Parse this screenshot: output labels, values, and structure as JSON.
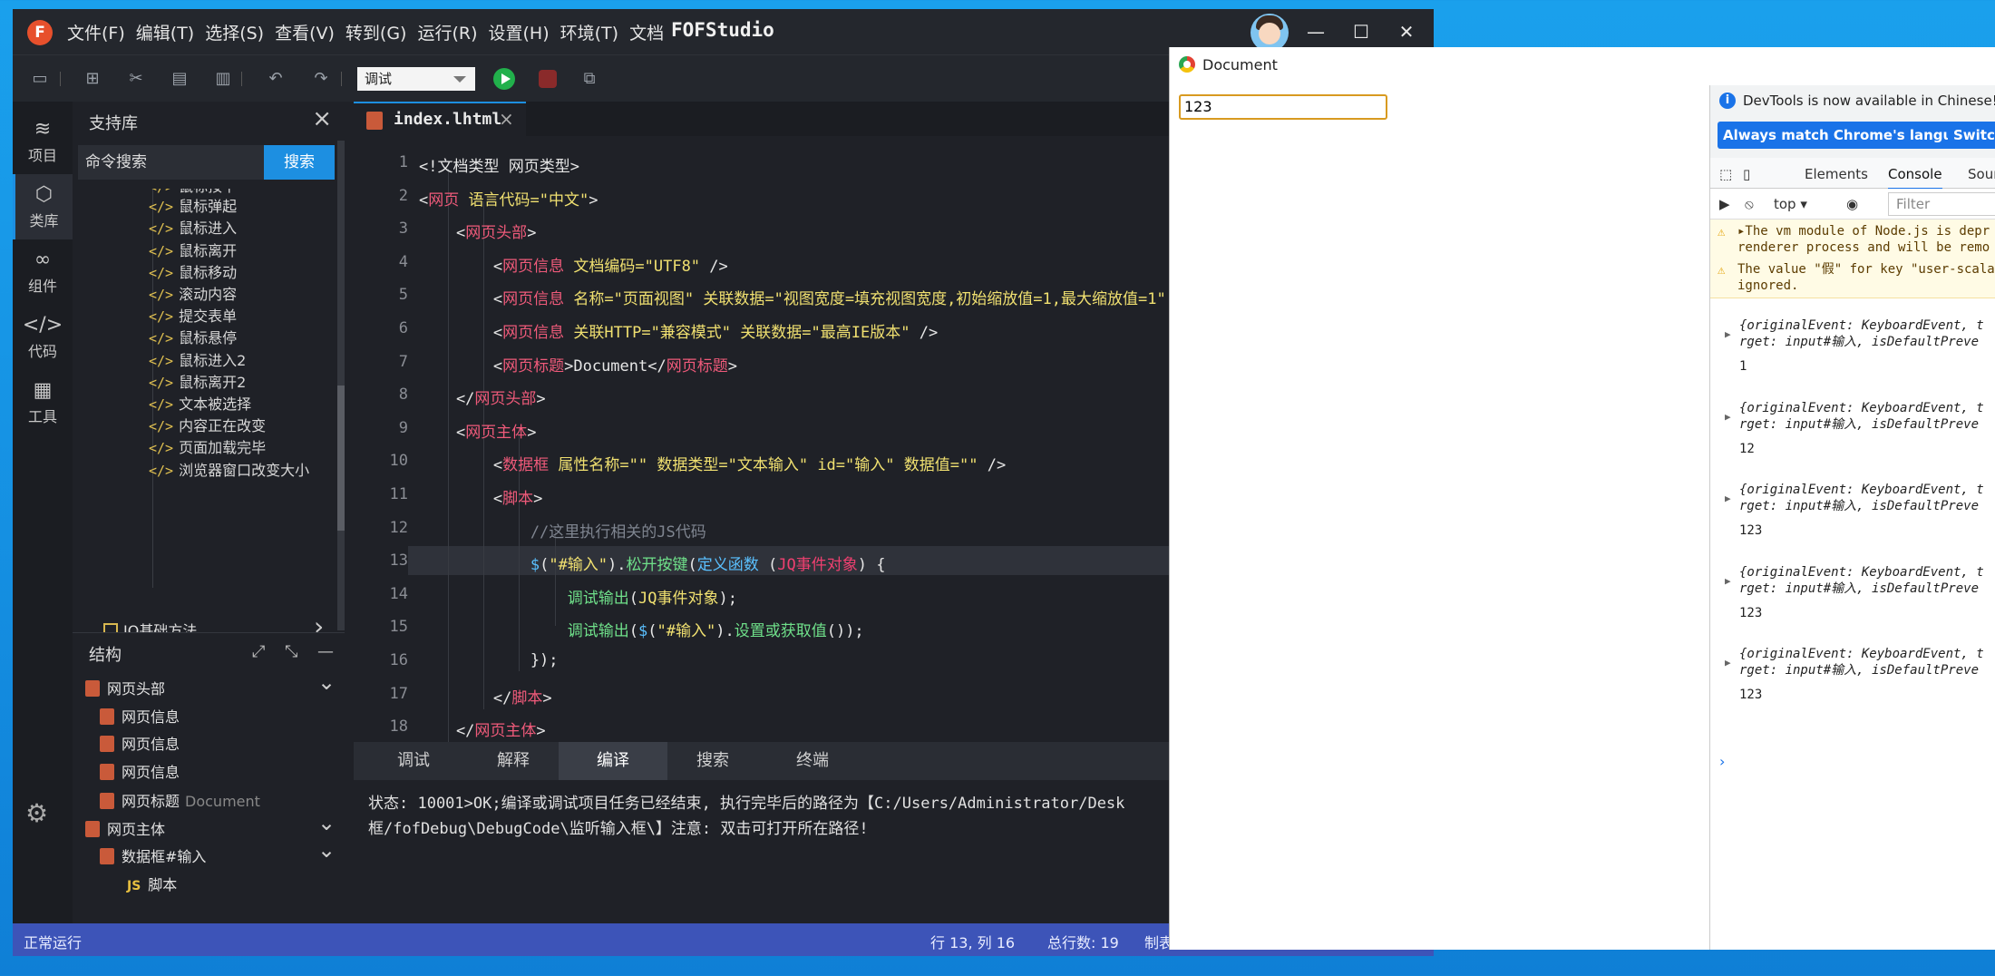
{
  "ide": {
    "logo": "F",
    "menu": [
      "文件(F)",
      "编辑(T)",
      "选择(S)",
      "查看(V)",
      "转到(G)",
      "运行(R)",
      "设置(H)",
      "环境(T)",
      "文档"
    ],
    "title": "FOFStudio",
    "window_controls": {
      "minimize": "—",
      "maximize": "☐",
      "close": "✕"
    },
    "toolbar": {
      "mode": "调试",
      "icons": [
        "save-icon",
        "new-file-icon",
        "cut-icon",
        "paste-icon",
        "delete-icon",
        "undo-icon",
        "redo-icon",
        "run-icon",
        "stop-icon",
        "debug-search-icon"
      ]
    },
    "activity": [
      {
        "label": "项目",
        "icon": "≋"
      },
      {
        "label": "类库",
        "icon": "⬡"
      },
      {
        "label": "组件",
        "icon": "∞"
      },
      {
        "label": "代码",
        "icon": "</>"
      },
      {
        "label": "工具",
        "icon": "▦"
      }
    ],
    "library": {
      "title": "支持库",
      "search_placeholder": "命令搜索",
      "search_button": "搜索",
      "items": [
        "鼠标按下",
        "鼠标弹起",
        "鼠标进入",
        "鼠标离开",
        "鼠标移动",
        "滚动内容",
        "提交表单",
        "鼠标悬停",
        "鼠标进入2",
        "鼠标离开2",
        "文本被选择",
        "内容正在改变",
        "页面加载完毕",
        "浏览器窗口改变大小"
      ],
      "tag": "</>",
      "group": "JQ基础方法"
    },
    "structure": {
      "title": "结构",
      "items": [
        {
          "label": "网页头部",
          "sub": "",
          "indent": 0,
          "kind": "doc"
        },
        {
          "label": "网页信息",
          "sub": "",
          "indent": 1,
          "kind": "doc"
        },
        {
          "label": "网页信息",
          "sub": "",
          "indent": 1,
          "kind": "doc"
        },
        {
          "label": "网页信息",
          "sub": "",
          "indent": 1,
          "kind": "doc"
        },
        {
          "label": "网页标题",
          "sub": "Document",
          "indent": 1,
          "kind": "doc"
        },
        {
          "label": "网页主体",
          "sub": "",
          "indent": 0,
          "kind": "doc"
        },
        {
          "label": "数据框#输入",
          "sub": "",
          "indent": 1,
          "kind": "doc"
        },
        {
          "label": "脚本",
          "sub": "",
          "indent": 2,
          "kind": "js"
        }
      ]
    },
    "editor": {
      "tab": "index.lhtml",
      "current_line": 13,
      "lines": [
        [
          [
            "<!文档类型 网页类型>",
            "wh"
          ]
        ],
        [
          [
            "<",
            "wh"
          ],
          [
            "网页 ",
            "kw"
          ],
          [
            "语言代码=",
            "at"
          ],
          [
            "\"中文\"",
            "st"
          ],
          [
            ">",
            "wh"
          ]
        ],
        [
          [
            "    <",
            "wh"
          ],
          [
            "网页头部",
            "kw"
          ],
          [
            ">",
            "wh"
          ]
        ],
        [
          [
            "        <",
            "wh"
          ],
          [
            "网页信息 ",
            "kw"
          ],
          [
            "文档编码=",
            "at"
          ],
          [
            "\"UTF8\"",
            "st"
          ],
          [
            " />",
            "wh"
          ]
        ],
        [
          [
            "        <",
            "wh"
          ],
          [
            "网页信息 ",
            "kw"
          ],
          [
            "名称=",
            "at"
          ],
          [
            "\"页面视图\" ",
            "st"
          ],
          [
            "关联数据=",
            "at"
          ],
          [
            "\"视图宽度=填充视图宽度,初始缩放值=1,最大缩放值=1\"",
            "st"
          ]
        ],
        [
          [
            "        <",
            "wh"
          ],
          [
            "网页信息 ",
            "kw"
          ],
          [
            "关联HTTP=",
            "at"
          ],
          [
            "\"兼容模式\" ",
            "st"
          ],
          [
            "关联数据=",
            "at"
          ],
          [
            "\"最高IE版本\"",
            "st"
          ],
          [
            " />",
            "wh"
          ]
        ],
        [
          [
            "        <",
            "wh"
          ],
          [
            "网页标题",
            "kw"
          ],
          [
            ">Document</",
            "wh"
          ],
          [
            "网页标题",
            "kw"
          ],
          [
            ">",
            "wh"
          ]
        ],
        [
          [
            "    </",
            "wh"
          ],
          [
            "网页头部",
            "kw"
          ],
          [
            ">",
            "wh"
          ]
        ],
        [
          [
            "    <",
            "wh"
          ],
          [
            "网页主体",
            "kw"
          ],
          [
            ">",
            "wh"
          ]
        ],
        [
          [
            "        <",
            "wh"
          ],
          [
            "数据框 ",
            "kw"
          ],
          [
            "属性名称=",
            "at"
          ],
          [
            "\"\" ",
            "st"
          ],
          [
            "数据类型=",
            "at"
          ],
          [
            "\"文本输入\" ",
            "st"
          ],
          [
            "id=",
            "at"
          ],
          [
            "\"输入\" ",
            "st"
          ],
          [
            "数据值=",
            "at"
          ],
          [
            "\"\"",
            "st"
          ],
          [
            " />",
            "wh"
          ]
        ],
        [
          [
            "        <",
            "wh"
          ],
          [
            "脚本",
            "kw"
          ],
          [
            ">",
            "wh"
          ]
        ],
        [
          [
            "            //这里执行相关的JS代码",
            "cm"
          ]
        ],
        [
          [
            "            ",
            "wh"
          ],
          [
            "$",
            "fn"
          ],
          [
            "(",
            "wh"
          ],
          [
            "\"#输入\"",
            "st"
          ],
          [
            ").",
            "wh"
          ],
          [
            "松开按键",
            "gr"
          ],
          [
            "(",
            "wh"
          ],
          [
            "定义函数",
            "fn"
          ],
          [
            " (",
            "wh"
          ],
          [
            "JQ事件对象",
            "pu"
          ],
          [
            ") {",
            "wh"
          ]
        ],
        [
          [
            "                ",
            "wh"
          ],
          [
            "调试输出",
            "gr"
          ],
          [
            "(",
            "wh"
          ],
          [
            "JQ事件对象",
            "at"
          ],
          [
            ");",
            "wh"
          ]
        ],
        [
          [
            "                ",
            "wh"
          ],
          [
            "调试输出",
            "gr"
          ],
          [
            "(",
            "wh"
          ],
          [
            "$",
            "fn"
          ],
          [
            "(",
            "wh"
          ],
          [
            "\"#输入\"",
            "st"
          ],
          [
            ").",
            "wh"
          ],
          [
            "设置或获取值",
            "gr"
          ],
          [
            "());",
            "wh"
          ]
        ],
        [
          [
            "            });",
            "wh"
          ]
        ],
        [
          [
            "        </",
            "wh"
          ],
          [
            "脚本",
            "kw"
          ],
          [
            ">",
            "wh"
          ]
        ],
        [
          [
            "    </",
            "wh"
          ],
          [
            "网页主体",
            "kw"
          ],
          [
            ">",
            "wh"
          ]
        ]
      ]
    },
    "bottom_tabs": [
      "调试",
      "解释",
      "编译",
      "搜索",
      "终端"
    ],
    "active_bottom_tab": "编译",
    "output": [
      "状态: 10001>OK;编译或调试项目任务已经结束, 执行完毕后的路径为【C:/Users/Administrator/Desk",
      "框/fofDebug\\DebugCode\\监听输入框\\】注意: 双击可打开所在路径!"
    ],
    "status": {
      "left": "正常运行",
      "pos": "行 13, 列 16",
      "total": "总行数: 19",
      "extra": "制表"
    }
  },
  "browser": {
    "title": "Document",
    "input_value": "123",
    "devtools": {
      "info": "DevTools is now available in Chinese!",
      "btn1": "Always match Chrome's language",
      "btn2": "Switch",
      "tabs": [
        "Elements",
        "Console",
        "Sour"
      ],
      "active_tab": "Console",
      "context": "top ▾",
      "filter": "Filter",
      "warnings": [
        "▸The vm module of Node.js is depr\nrenderer process and will be remo",
        "The value \"假\" for key \"user-scala\nignored."
      ],
      "logs": [
        {
          "obj": "{originalEvent: KeyboardEvent, t\nrget: input#输入, isDefaultPreve",
          "val": "1"
        },
        {
          "obj": "{originalEvent: KeyboardEvent, t\nrget: input#输入, isDefaultPreve",
          "val": "12"
        },
        {
          "obj": "{originalEvent: KeyboardEvent, t\nrget: input#输入, isDefaultPreve",
          "val": "123"
        },
        {
          "obj": "{originalEvent: KeyboardEvent, t\nrget: input#输入, isDefaultPreve",
          "val": "123"
        },
        {
          "obj": "{originalEvent: KeyboardEvent, t\nrget: input#输入, isDefaultPreve",
          "val": "123"
        }
      ]
    }
  }
}
